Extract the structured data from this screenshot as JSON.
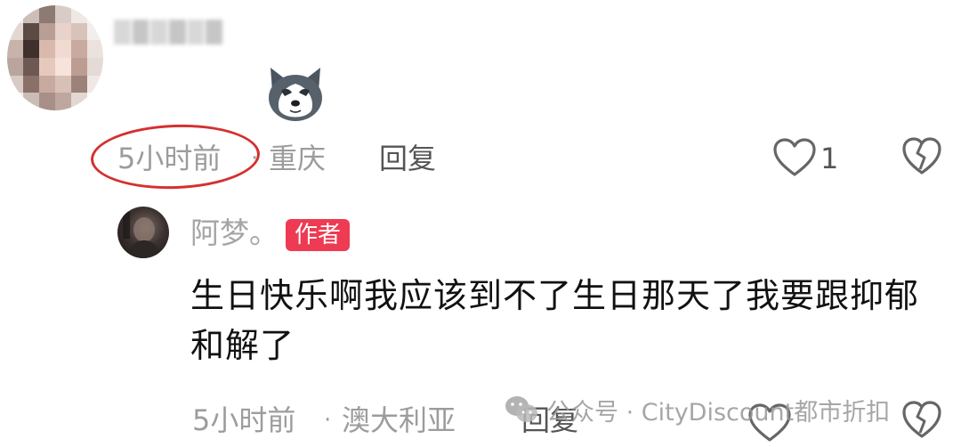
{
  "comment": {
    "time": "5小时前",
    "separator": "·",
    "location": "重庆",
    "reply_label": "回复",
    "like_count": "1",
    "sticker_icon": "husky-face-sticker"
  },
  "reply": {
    "author_name": "阿梦。",
    "author_badge": "作者",
    "text": "生日快乐啊我应该到不了生日那天了我要跟抑郁和解了",
    "time": "5小时前",
    "separator": "·",
    "location": "澳大利亚",
    "reply_label": "回复"
  },
  "watermark": {
    "text": "公众号 · CityDiscount都市折扣",
    "icon": "wechat-icon"
  },
  "colors": {
    "annotation_circle": "#d4302f",
    "author_badge": "#ee3a52",
    "meta_text": "#9c9c9c"
  }
}
